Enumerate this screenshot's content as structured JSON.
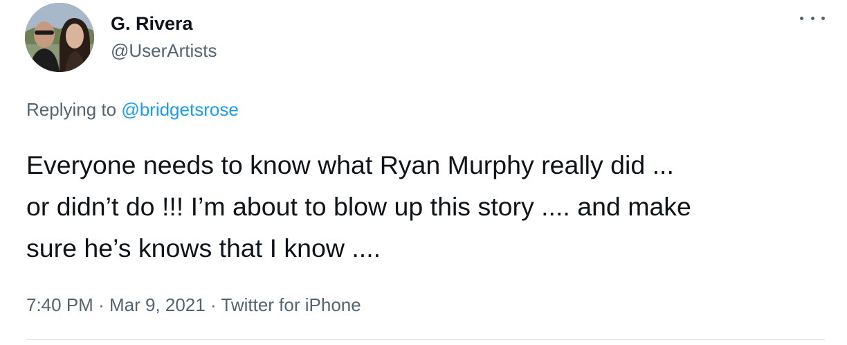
{
  "author": {
    "name": "G. Rivera",
    "handle": "@UserArtists"
  },
  "reply": {
    "prefix": "Replying to",
    "to_handle": "@bridgetsrose"
  },
  "tweet": {
    "lines": [
      "Everyone needs to know what Ryan Murphy really did ...",
      "or didn’t do !!! I’m about to blow up this story .... and make",
      "sure he’s knows that I know ...."
    ]
  },
  "meta": {
    "time": "7:40 PM",
    "date": "Mar 9, 2021",
    "source": "Twitter for iPhone",
    "separator": "·"
  },
  "icons": {
    "more": "more-horizontal-icon",
    "avatar": "avatar-photo"
  },
  "colors": {
    "text_primary": "#0f1419",
    "text_secondary": "#536471",
    "link": "#1d9bf0"
  }
}
